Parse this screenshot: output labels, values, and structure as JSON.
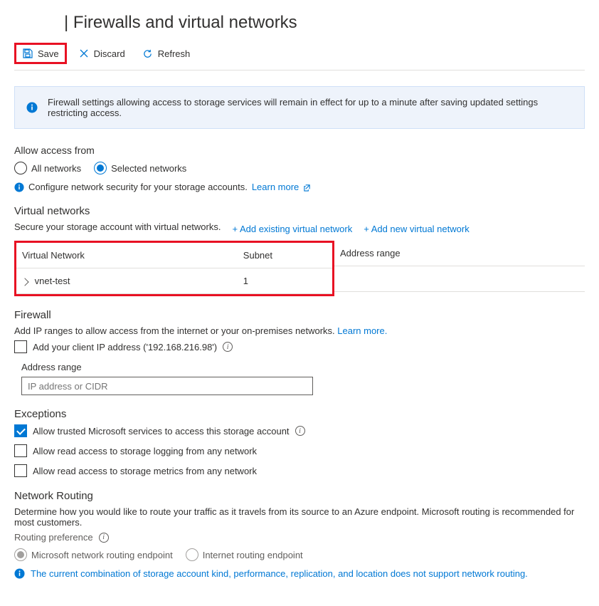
{
  "page": {
    "title": "| Firewalls and virtual networks"
  },
  "toolbar": {
    "save": "Save",
    "discard": "Discard",
    "refresh": "Refresh"
  },
  "banner": {
    "text": "Firewall settings allowing access to storage services will remain in effect for up to a minute after saving updated settings restricting access."
  },
  "access": {
    "label": "Allow access from",
    "all": "All networks",
    "selected": "Selected networks"
  },
  "config": {
    "text": "Configure network security for your storage accounts.",
    "learn_more": "Learn more"
  },
  "vnet": {
    "heading": "Virtual networks",
    "subtext": "Secure your storage account with virtual networks.",
    "add_existing": "+ Add existing virtual network",
    "add_new": "+ Add new virtual network",
    "col_network": "Virtual Network",
    "col_subnet": "Subnet",
    "col_range": "Address range",
    "row_name": "vnet-test",
    "row_subnet": "1"
  },
  "firewall": {
    "heading": "Firewall",
    "subtext": "Add IP ranges to allow access from the internet or your on-premises networks.",
    "learn_more": "Learn more.",
    "add_client_ip": "Add your client IP address ('192.168.216.98')",
    "range_label": "Address range",
    "range_placeholder": "IP address or CIDR"
  },
  "exceptions": {
    "heading": "Exceptions",
    "allow_trusted": "Allow trusted Microsoft services to access this storage account",
    "allow_logging": "Allow read access to storage logging from any network",
    "allow_metrics": "Allow read access to storage metrics from any network"
  },
  "routing": {
    "heading": "Network Routing",
    "subtext": "Determine how you would like to route your traffic as it travels from its source to an Azure endpoint. Microsoft routing is recommended for most customers.",
    "pref_label": "Routing preference",
    "opt_ms": "Microsoft network routing endpoint",
    "opt_internet": "Internet routing endpoint",
    "warning": "The current combination of storage account kind, performance, replication, and location does not support network routing."
  }
}
